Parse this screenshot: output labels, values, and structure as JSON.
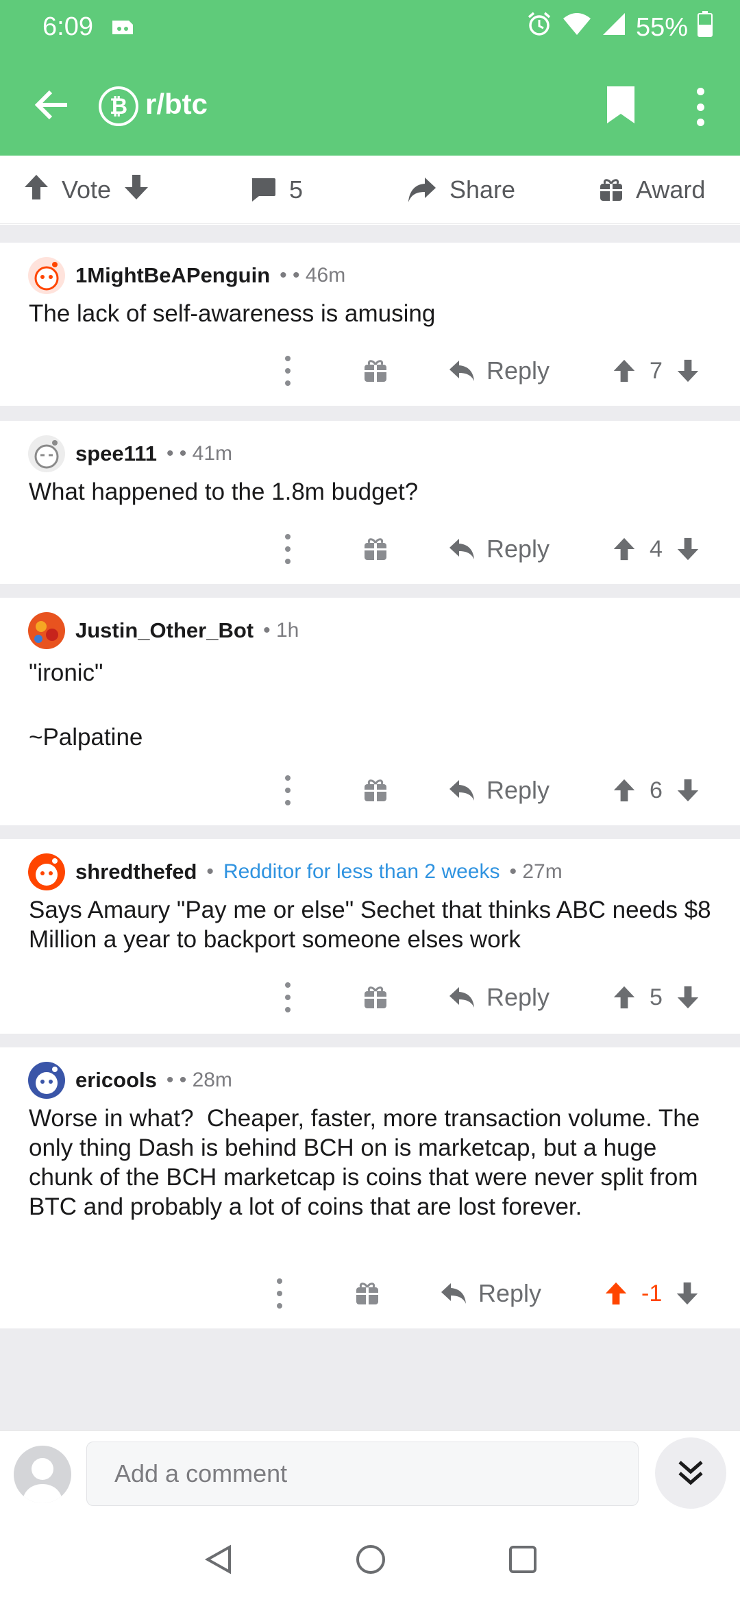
{
  "status": {
    "time": "6:09",
    "battery": "55%"
  },
  "header": {
    "subreddit": "r/btc",
    "sub_icon_glyph": "₿"
  },
  "actions": {
    "vote": "Vote",
    "comments": "5",
    "share": "Share",
    "award": "Award"
  },
  "comments": [
    {
      "author": "1MightBeAPenguin",
      "meta": "• • 46m",
      "flair": "",
      "body": "The lack of self-awareness is amusing",
      "reply": "Reply",
      "score": "7",
      "avatar_color": "#ff4500"
    },
    {
      "author": "spee111",
      "meta": "• • 41m",
      "flair": "",
      "body": "What happened to the 1.8m budget?",
      "reply": "Reply",
      "score": "4",
      "avatar_color": "#9a9a9a"
    },
    {
      "author": "Justin_Other_Bot",
      "meta": "• 1h",
      "flair": "",
      "body": "\"ironic\"\n\n~Palpatine",
      "reply": "Reply",
      "score": "6",
      "avatar_color": "#e8531f"
    },
    {
      "author": "shredthefed",
      "meta": "•",
      "flair": "Redditor for less than 2 weeks",
      "meta2": "• 27m",
      "body": "Says Amaury \"Pay me or else\" Sechet that thinks ABC needs $8 Million a year to backport someone elses work",
      "reply": "Reply",
      "score": "5",
      "avatar_color": "#ff4500"
    },
    {
      "author": "ericools",
      "meta": "• • 28m",
      "flair": "",
      "body": "Worse in what?  Cheaper, faster, more transaction volume. The only thing Dash is behind BCH on is marketcap, but a huge chunk of the BCH marketcap is coins that were never split from BTC and probably a lot of coins that are lost forever.",
      "reply": "Reply",
      "score": "-1",
      "avatar_color": "#3a55a8",
      "upvoted_color": "#ff4500"
    }
  ],
  "composer": {
    "placeholder": "Add a comment"
  },
  "colors": {
    "header": "#5fcb7a",
    "flair": "#2f93e0",
    "upvote": "#ff4500"
  }
}
